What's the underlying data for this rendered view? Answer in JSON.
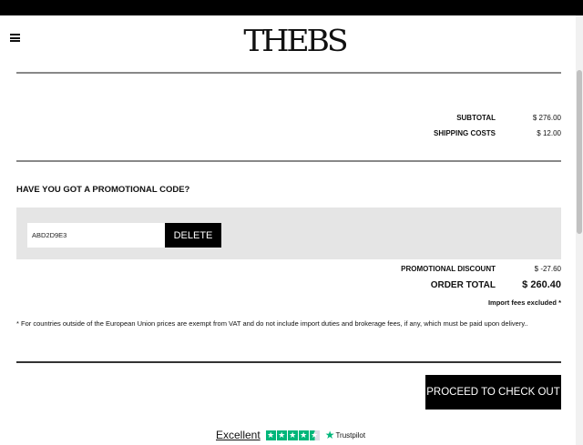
{
  "header": {
    "logo_text": "THEBS"
  },
  "summary": {
    "subtotal_label": "SUBTOTAL",
    "subtotal_value": "$ 276.00",
    "shipping_label": "SHIPPING COSTS",
    "shipping_value": "$ 12.00"
  },
  "promo": {
    "title": "HAVE YOU GOT A PROMOTIONAL CODE?",
    "code_value": "ABD2D9E3",
    "delete_label": "DELETE"
  },
  "totals": {
    "discount_label": "PROMOTIONAL DISCOUNT",
    "discount_value": "$ -27.60",
    "total_label": "ORDER TOTAL",
    "total_value": "$ 260.40",
    "import_note": "Import fees excluded *"
  },
  "disclaimer": "* For countries outside of the European Union prices are exempt from VAT and do not include import duties and brokerage fees, if any, which must be paid upon delivery..",
  "checkout": {
    "label": "PROCEED TO CHECK OUT"
  },
  "trustpilot": {
    "rating_text": "Excellent",
    "brand": "Trustpilot",
    "stars": 4.5,
    "star_color": "#00b67a"
  }
}
